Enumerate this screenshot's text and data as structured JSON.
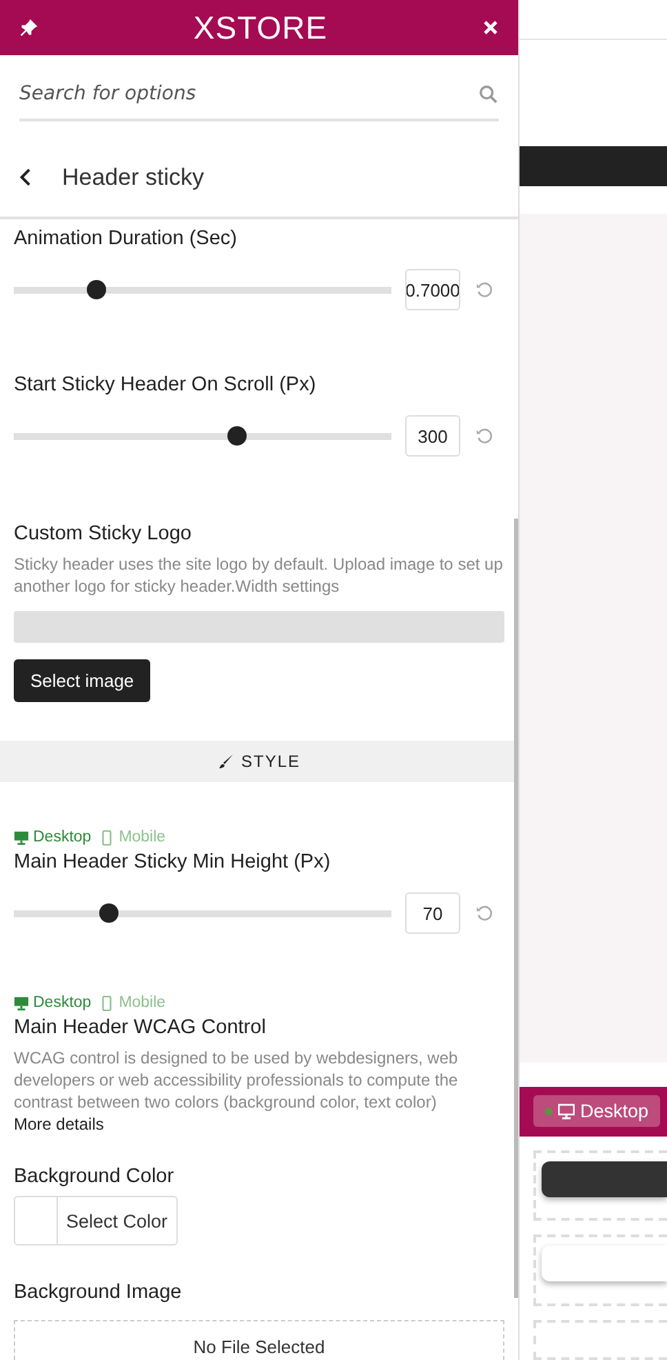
{
  "header": {
    "logo": "XSTORE"
  },
  "search": {
    "placeholder": "Search for options"
  },
  "section": {
    "title": "Header sticky"
  },
  "controls": [
    {
      "kind": "slider",
      "label": "Animation Duration (Sec)",
      "level": 0.22,
      "value": "0.7000"
    },
    {
      "kind": "slider",
      "label": "Start Sticky Header On Scroll (Px)",
      "level": 0.59,
      "value": "300"
    },
    {
      "kind": "image",
      "label": "Custom Sticky Logo",
      "description": "Sticky header uses the site logo by default. Upload image to set up another logo for sticky header.Width settings",
      "button": "Select image"
    },
    {
      "kind": "divider",
      "label": "STYLE"
    },
    {
      "kind": "slider",
      "label": "Main Header Sticky Min Height (Px)",
      "level": 0.25,
      "value": "70",
      "devices": [
        {
          "label": "Desktop",
          "selected": true
        },
        {
          "label": "Mobile",
          "selected": false
        }
      ]
    },
    {
      "kind": "wcag",
      "label": "Main Header WCAG Control",
      "description": "WCAG control is designed to be used by webdesigners, web developers or web accessibility professionals to compute the contrast between two colors (background color, text color)",
      "link": "More details",
      "devices": [
        {
          "label": "Desktop",
          "selected": true
        },
        {
          "label": "Mobile",
          "selected": false
        }
      ]
    },
    {
      "kind": "color",
      "label": "Background Color",
      "button": "Select Color"
    },
    {
      "kind": "file",
      "label": "Background Image",
      "placeholder": "No File Selected"
    }
  ],
  "preview": {
    "device_button": "Desktop"
  }
}
